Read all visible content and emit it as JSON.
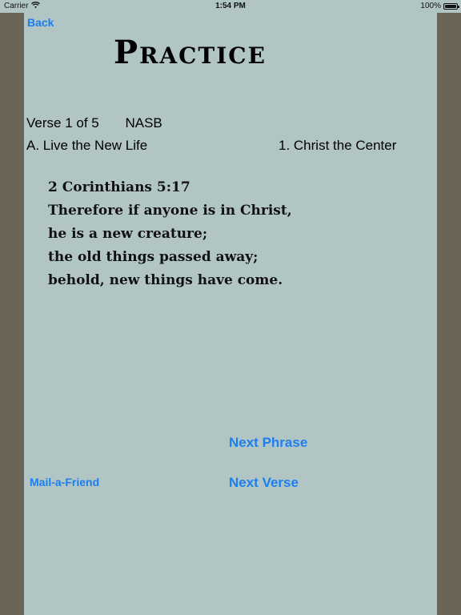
{
  "status_bar": {
    "carrier": "Carrier",
    "time": "1:54 PM",
    "battery": "100%",
    "battery_level": 1.0
  },
  "nav": {
    "back_label": "Back"
  },
  "page": {
    "title": "Practice"
  },
  "verse": {
    "position": "Verse 1 of 5",
    "version": "NASB",
    "topic": "A. Live the New Life",
    "subtopic": "1. Christ the Center",
    "lines": [
      "2 Corinthians 5:17",
      "Therefore if anyone is in Christ,",
      "he is a new creature;",
      "the old things passed away;",
      "behold, new things have come."
    ]
  },
  "actions": {
    "next_phrase": "Next Phrase",
    "next_verse": "Next Verse",
    "mail_friend": "Mail-a-Friend"
  },
  "colors": {
    "panel": "#b2c5c5",
    "frame": "#6b6457",
    "link": "#1a7ff0"
  },
  "icons": [
    "wifi-icon",
    "battery-icon"
  ]
}
